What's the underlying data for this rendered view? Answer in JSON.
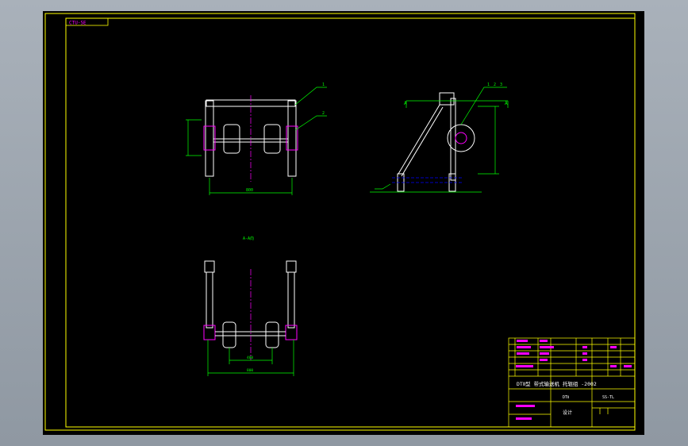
{
  "drawing": {
    "frame_tag": "CTU-SE",
    "front_view": {
      "dims": [
        "800"
      ],
      "callouts": [
        "1",
        "2"
      ]
    },
    "side_view": {
      "section_marks": [
        "A",
        "A"
      ],
      "callouts": [
        "1",
        "2",
        "3"
      ]
    },
    "top_view": {
      "label": "A-A向",
      "dims": [
        "400",
        "800"
      ]
    },
    "title_block": {
      "title": "DTⅡ型 带式输送机 托辊组 -2002",
      "code": "DTⅡ",
      "drawing_no": "SS-TL",
      "name": "设计"
    }
  },
  "colors": {
    "background": "#000000",
    "frame": "#ffff00",
    "outline": "#ffffff",
    "dimension": "#00ff00",
    "annotation": "#ff00ff",
    "hidden": "#0000ff",
    "secondary": "#00ffff"
  }
}
